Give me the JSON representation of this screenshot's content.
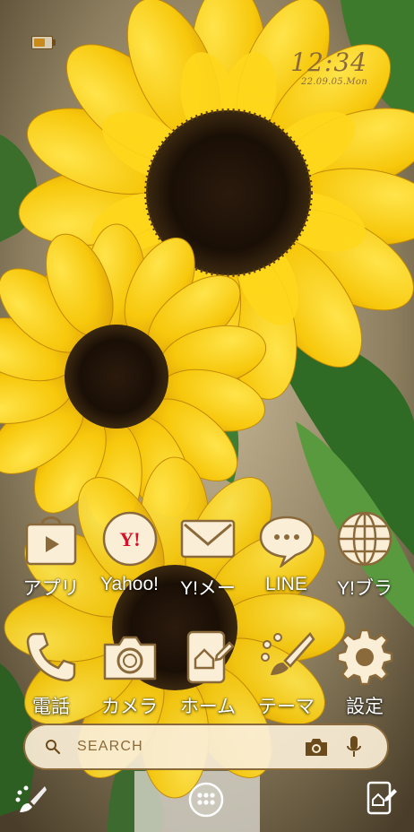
{
  "status_bar": {
    "battery_icon": "battery-icon",
    "clock_time": "12:34",
    "clock_date": "22.09.05.Mon"
  },
  "apps": [
    {
      "label": "アプリ",
      "icon": "play-bag-icon"
    },
    {
      "label": "Yahoo!",
      "icon": "yahoo-icon",
      "badge": "Y!"
    },
    {
      "label": "Y!メー",
      "icon": "mail-icon"
    },
    {
      "label": "LINE",
      "icon": "chat-bubble-icon"
    },
    {
      "label": "Y!ブラ",
      "icon": "globe-icon"
    },
    {
      "label": "電話",
      "icon": "phone-icon"
    },
    {
      "label": "カメラ",
      "icon": "camera-icon"
    },
    {
      "label": "ホーム",
      "icon": "home-edit-icon"
    },
    {
      "label": "テーマ",
      "icon": "brush-icon"
    },
    {
      "label": "設定",
      "icon": "gear-icon"
    }
  ],
  "search": {
    "placeholder": "SEARCH",
    "search_icon": "search-icon",
    "camera_icon": "camera-icon",
    "mic_icon": "mic-icon"
  },
  "dock": {
    "left_icon": "brush-icon",
    "center_icon": "app-drawer-icon",
    "right_icon": "home-edit-icon"
  },
  "colors": {
    "accent_brown": "#8a6a3a",
    "icon_cream": "#faeed7",
    "label_white": "#ffffff"
  }
}
